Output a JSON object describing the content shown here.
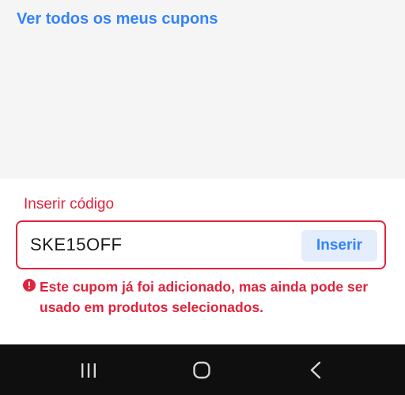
{
  "coupons": {
    "view_all_label": "Ver todos os meus cupons"
  },
  "coupon_form": {
    "label": "Inserir código",
    "input_value": "SKE15OFF",
    "submit_label": "Inserir",
    "error_icon": "alert-circle-icon",
    "error_message": "Este cupom já foi adicionado, mas ainda pode ser usado em produtos selecionados."
  },
  "navbar": {
    "recents_icon": "recent-apps-icon",
    "home_icon": "home-icon",
    "back_icon": "back-icon"
  },
  "colors": {
    "accent": "#3483fa",
    "error": "#e0233b",
    "button_bg": "#e3edfb",
    "navbar_bg": "#0f0f0f"
  }
}
